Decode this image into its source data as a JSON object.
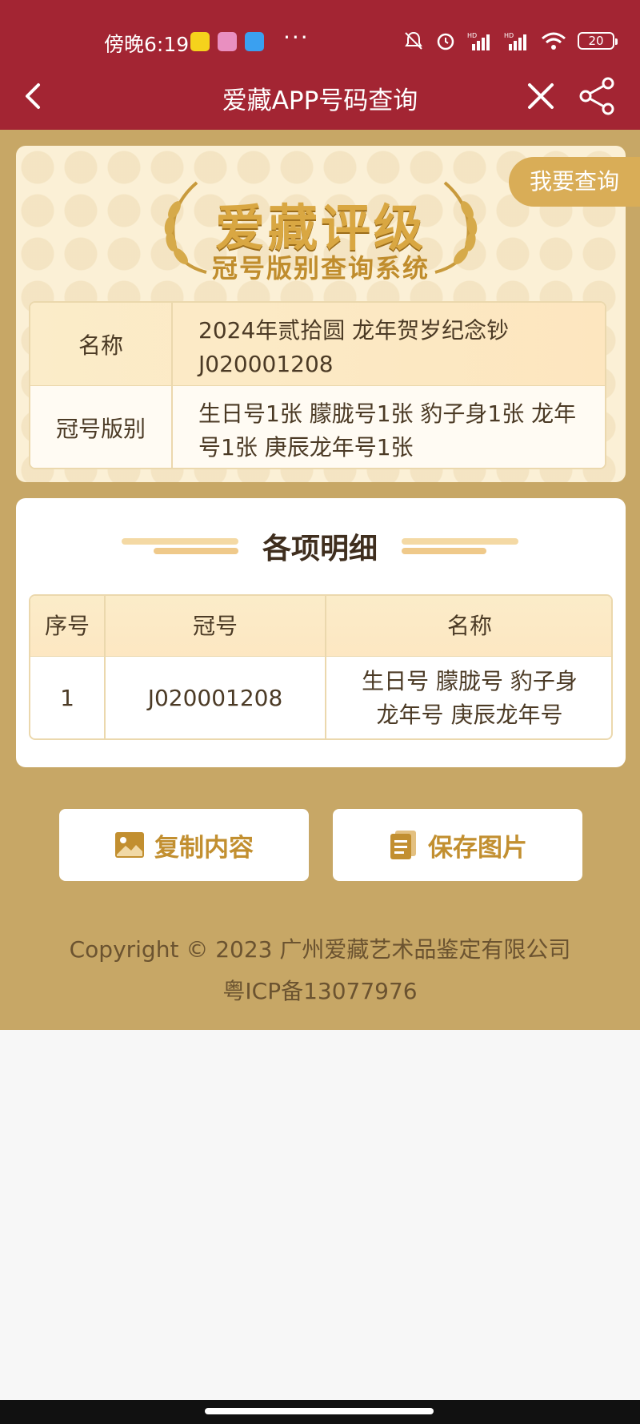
{
  "status_bar": {
    "time": "傍晚6:19",
    "dots": "···",
    "battery": "20"
  },
  "nav": {
    "title": "爱藏APP号码查询"
  },
  "query_button": "我要查询",
  "logo": {
    "title": "爱藏评级",
    "subtitle": "冠号版别查询系统"
  },
  "info": [
    {
      "label": "名称",
      "value": "2024年贰拾圆 龙年贺岁纪念钞 J020001208"
    },
    {
      "label": "冠号版别",
      "value": "生日号1张 朦胧号1张 豹子身1张 龙年号1张 庚辰龙年号1张"
    }
  ],
  "details": {
    "title": "各项明细",
    "headers": [
      "序号",
      "冠号",
      "名称"
    ],
    "rows": [
      {
        "index": "1",
        "serial": "J020001208",
        "name": "生日号 朦胧号 豹子身 龙年号  庚辰龙年号"
      }
    ]
  },
  "actions": {
    "copy": "复制内容",
    "save": "保存图片"
  },
  "footer": {
    "copyright": "Copyright © 2023 广州爱藏艺术品鉴定有限公司",
    "icp": "粤ICP备13077976"
  },
  "colors": {
    "header": "#a32533",
    "background": "#c7a766",
    "accent": "#c28f30"
  },
  "icons": [
    "back-icon",
    "close-icon",
    "share-icon",
    "image-icon",
    "document-icon"
  ]
}
